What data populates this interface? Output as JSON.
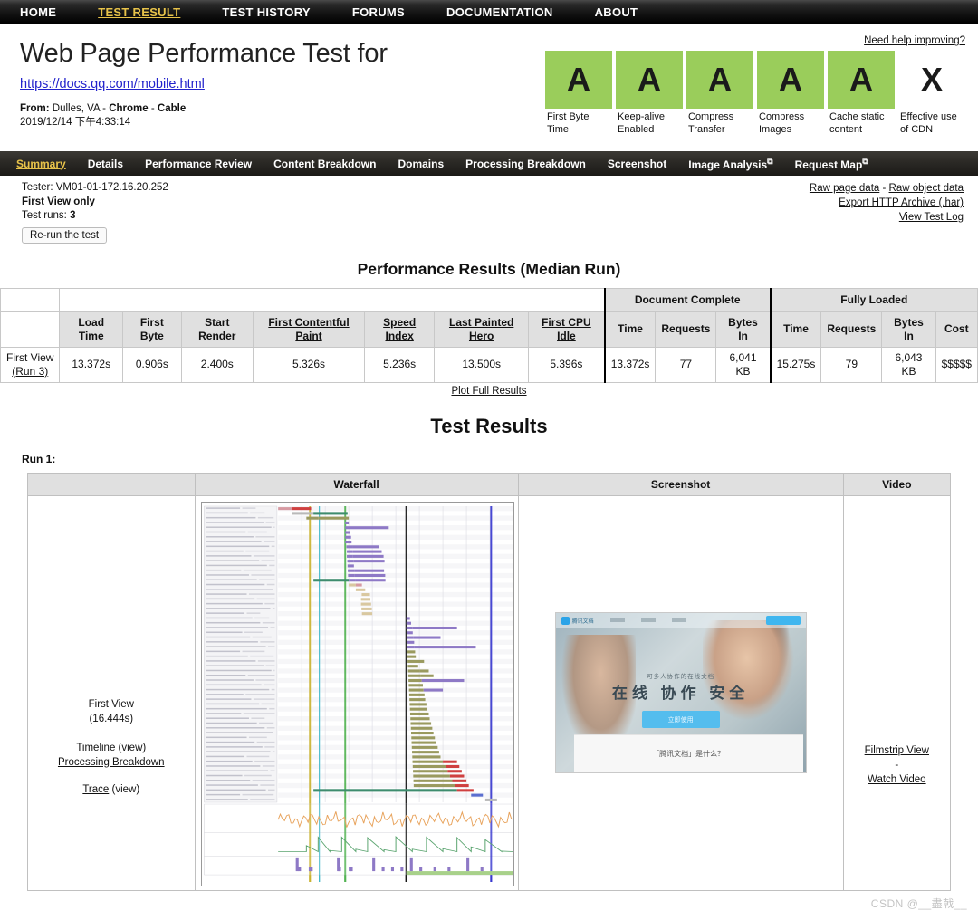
{
  "topnav": {
    "items": [
      {
        "label": "HOME",
        "active": false
      },
      {
        "label": "TEST RESULT",
        "active": true
      },
      {
        "label": "TEST HISTORY",
        "active": false
      },
      {
        "label": "FORUMS",
        "active": false
      },
      {
        "label": "DOCUMENTATION",
        "active": false
      },
      {
        "label": "ABOUT",
        "active": false
      }
    ]
  },
  "header": {
    "title": "Web Page Performance Test for",
    "url": "https://docs.qq.com/mobile.html",
    "from_prefix": "From: ",
    "from_location": "Dulles, VA",
    "from_sep1": " - ",
    "from_browser": "Chrome",
    "from_sep2": " - ",
    "from_connection": "Cable",
    "timestamp": "2019/12/14 下午4:33:14",
    "help_link": "Need help improving?",
    "grade_color": "#9ACD5B",
    "grades": [
      {
        "grade": "A",
        "label": "First Byte Time",
        "graded": true
      },
      {
        "grade": "A",
        "label": "Keep-alive Enabled",
        "graded": true
      },
      {
        "grade": "A",
        "label": "Compress Transfer",
        "graded": true
      },
      {
        "grade": "A",
        "label": "Compress Images",
        "graded": true
      },
      {
        "grade": "A",
        "label": "Cache static content",
        "graded": true
      },
      {
        "grade": "X",
        "label": "Effective use of CDN",
        "graded": false
      }
    ]
  },
  "subnav": {
    "items": [
      {
        "label": "Summary",
        "active": true,
        "external": false
      },
      {
        "label": "Details",
        "active": false,
        "external": false
      },
      {
        "label": "Performance Review",
        "active": false,
        "external": false
      },
      {
        "label": "Content Breakdown",
        "active": false,
        "external": false
      },
      {
        "label": "Domains",
        "active": false,
        "external": false
      },
      {
        "label": "Processing Breakdown",
        "active": false,
        "external": false
      },
      {
        "label": "Screenshot",
        "active": false,
        "external": false
      },
      {
        "label": "Image Analysis",
        "active": false,
        "external": true
      },
      {
        "label": "Request Map",
        "active": false,
        "external": true
      }
    ]
  },
  "info": {
    "tester_label": "Tester: ",
    "tester_value": "VM01-01-172.16.20.252",
    "view_mode": "First View only",
    "test_runs_label": "Test runs: ",
    "test_runs_value": "3",
    "rerun_button": "Re-run the test",
    "raw_page_data": "Raw page data",
    "raw_sep": " - ",
    "raw_object_data": "Raw object data",
    "export_har": "Export HTTP Archive (.har)",
    "view_test_log": "View Test Log"
  },
  "perf": {
    "title": "Performance Results (Median Run)",
    "group_headers": [
      {
        "label": "Document Complete",
        "span": 3
      },
      {
        "label": "Fully Loaded",
        "span": 4
      }
    ],
    "columns": [
      {
        "label": "Load Time",
        "underline": false
      },
      {
        "label": "First Byte",
        "underline": false
      },
      {
        "label": "Start Render",
        "underline": false
      },
      {
        "label": "First Contentful Paint",
        "underline": true
      },
      {
        "label": "Speed Index",
        "underline": true
      },
      {
        "label": "Last Painted Hero",
        "underline": true
      },
      {
        "label": "First CPU Idle",
        "underline": true
      },
      {
        "label": "Time",
        "underline": false
      },
      {
        "label": "Requests",
        "underline": false
      },
      {
        "label": "Bytes In",
        "underline": false
      },
      {
        "label": "Time",
        "underline": false
      },
      {
        "label": "Requests",
        "underline": false
      },
      {
        "label": "Bytes In",
        "underline": false
      },
      {
        "label": "Cost",
        "underline": false
      }
    ],
    "row_label_line1": "First View",
    "row_label_line2": "(Run 3)",
    "values": [
      "13.372s",
      "0.906s",
      "2.400s",
      "5.326s",
      "5.236s",
      "13.500s",
      "5.396s",
      "13.372s",
      "77",
      "6,041 KB",
      "15.275s",
      "79",
      "6,043 KB",
      "$$$$$"
    ],
    "plot_link": "Plot Full Results"
  },
  "results": {
    "title": "Test Results",
    "run_label": "Run 1:",
    "columns": [
      "Waterfall",
      "Screenshot",
      "Video"
    ],
    "first_view_line1": "First View",
    "first_view_line2": "(16.444s)",
    "timeline_link": "Timeline",
    "timeline_view": "(view)",
    "processing_breakdown_link": "Processing Breakdown",
    "trace_link": "Trace",
    "trace_view": "(view)",
    "filmstrip_link": "Filmstrip View",
    "video_sep": "-",
    "watch_video_link": "Watch Video",
    "screenshot_thumb": {
      "brand": "腾讯文档",
      "subhead": "可多人协作的在线文档",
      "headline": "在线 协作 安全",
      "cta": "立即使用",
      "footer_text": "「腾讯文档」是什么？"
    }
  },
  "watermark": "CSDN @__盡戟__"
}
